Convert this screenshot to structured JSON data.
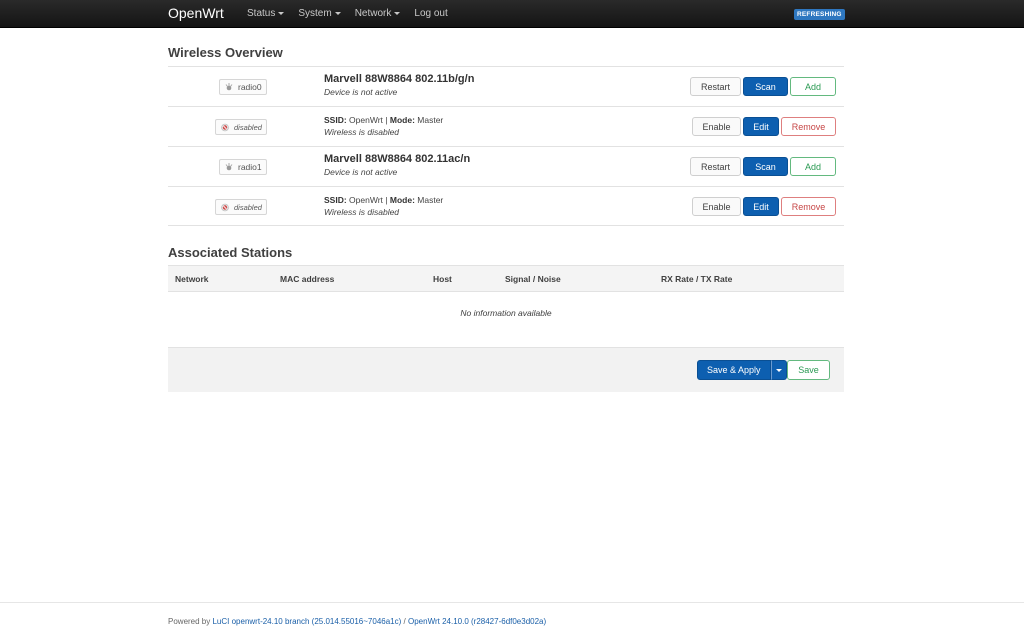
{
  "header": {
    "brand": "OpenWrt",
    "menu": [
      {
        "label": "Status",
        "has_caret": true
      },
      {
        "label": "System",
        "has_caret": true
      },
      {
        "label": "Network",
        "has_caret": true
      },
      {
        "label": "Log out",
        "has_caret": false
      }
    ],
    "refresh_badge": "REFRESHING"
  },
  "wireless": {
    "title": "Wireless Overview",
    "rows": [
      {
        "kind": "radio",
        "badge": "radio0",
        "title": "Marvell 88W8864 802.11b/g/n",
        "status": "Device is not active",
        "buttons": [
          "Restart",
          "Scan",
          "Add"
        ]
      },
      {
        "kind": "iface",
        "badge": "disabled",
        "ssid_label": "SSID:",
        "ssid": "OpenWrt",
        "sep": "|",
        "mode_label": "Mode:",
        "mode": "Master",
        "status": "Wireless is disabled",
        "buttons": [
          "Enable",
          "Edit",
          "Remove"
        ]
      },
      {
        "kind": "radio",
        "badge": "radio1",
        "title": "Marvell 88W8864 802.11ac/n",
        "status": "Device is not active",
        "buttons": [
          "Restart",
          "Scan",
          "Add"
        ]
      },
      {
        "kind": "iface",
        "badge": "disabled",
        "ssid_label": "SSID:",
        "ssid": "OpenWrt",
        "sep": "|",
        "mode_label": "Mode:",
        "mode": "Master",
        "status": "Wireless is disabled",
        "buttons": [
          "Enable",
          "Edit",
          "Remove"
        ]
      }
    ]
  },
  "stations": {
    "title": "Associated Stations",
    "columns": [
      "Network",
      "MAC address",
      "Host",
      "Signal / Noise",
      "RX Rate / TX Rate"
    ],
    "empty": "No information available"
  },
  "actions": {
    "save_apply": "Save & Apply",
    "save": "Save"
  },
  "footer": {
    "prefix": "Powered by",
    "luci": "LuCI openwrt-24.10 branch (25.014.55016~7046a1c)",
    "sep": "/",
    "openwrt": "OpenWrt 24.10.0 (r28427-6df0e3d02a)"
  },
  "colors": {
    "primary": "#0d5fb0",
    "positive": "#2a9a53",
    "negative": "#c64646",
    "badge": "#2e77c0"
  }
}
